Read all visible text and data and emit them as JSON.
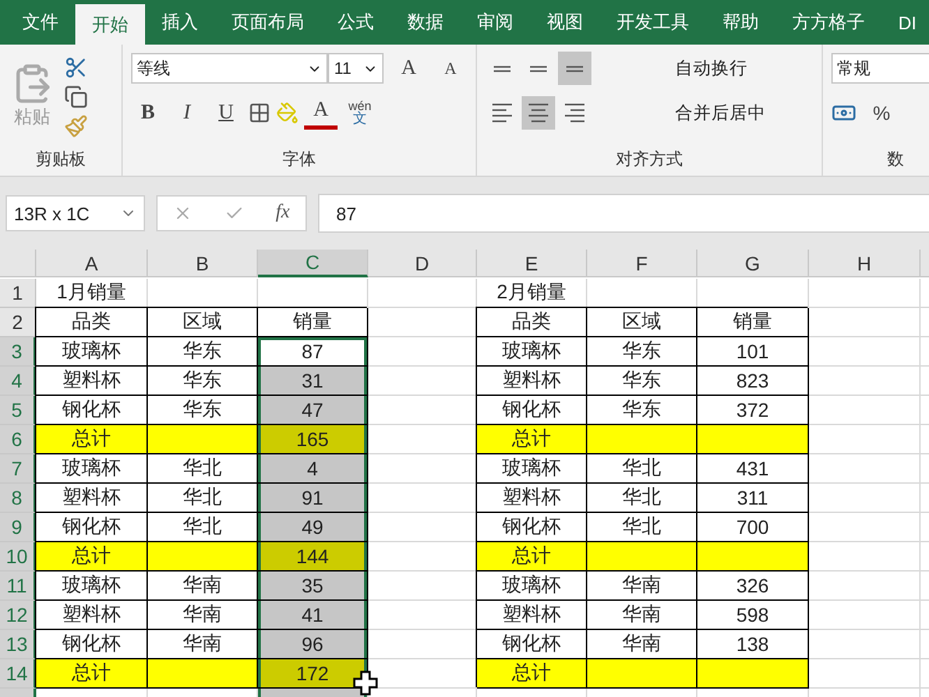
{
  "tabs": [
    {
      "label": "文件",
      "selected": false
    },
    {
      "label": "开始",
      "selected": true
    },
    {
      "label": "插入",
      "selected": false
    },
    {
      "label": "页面布局",
      "selected": false
    },
    {
      "label": "公式",
      "selected": false
    },
    {
      "label": "数据",
      "selected": false
    },
    {
      "label": "审阅",
      "selected": false
    },
    {
      "label": "视图",
      "selected": false
    },
    {
      "label": "开发工具",
      "selected": false
    },
    {
      "label": "帮助",
      "selected": false
    },
    {
      "label": "方方格子",
      "selected": false
    },
    {
      "label": "DI",
      "selected": false
    }
  ],
  "ribbon": {
    "clipboard": {
      "label": "剪贴板",
      "paste": "粘贴"
    },
    "font": {
      "label": "字体",
      "name": "等线",
      "size": "11",
      "grow": "A",
      "shrink": "A",
      "bold": "B",
      "italic": "I",
      "underline": "U",
      "font_color": "A",
      "phonetic": "wén",
      "phonetic_char": "文"
    },
    "alignment": {
      "label": "对齐方式",
      "wrap": "自动换行",
      "merge": "合并后居中",
      "vertical": [
        {
          "selected": false
        },
        {
          "selected": false
        },
        {
          "selected": true
        }
      ],
      "horizontal": [
        {
          "selected": false
        },
        {
          "selected": true
        },
        {
          "selected": false
        }
      ]
    },
    "number": {
      "format": "常规",
      "percent": "%",
      "label": "数"
    }
  },
  "formula_bar": {
    "name_box": "13R x 1C",
    "function_label": "fx",
    "value": "87"
  },
  "sheet": {
    "columns": [
      {
        "label": "A",
        "selected": false
      },
      {
        "label": "B",
        "selected": false
      },
      {
        "label": "C",
        "selected": true
      },
      {
        "label": "D",
        "selected": false
      },
      {
        "label": "E",
        "selected": false
      },
      {
        "label": "F",
        "selected": false
      },
      {
        "label": "G",
        "selected": false
      },
      {
        "label": "H",
        "selected": false
      }
    ],
    "rows": [
      {
        "number": "1",
        "selected": false,
        "cells": [
          {
            "text": "1月销量",
            "highlight": false,
            "border": false,
            "selected": false
          },
          {
            "highlight": false,
            "border": false,
            "selected": false
          },
          {
            "highlight": false,
            "border": false,
            "selected": false
          },
          {
            "highlight": false,
            "border": false,
            "selected": false
          },
          {
            "text": "2月销量",
            "highlight": false,
            "border": false,
            "selected": false
          },
          {
            "highlight": false,
            "border": false,
            "selected": false
          },
          {
            "highlight": false,
            "border": false,
            "selected": false
          },
          {
            "highlight": false,
            "border": false,
            "selected": false
          }
        ]
      },
      {
        "number": "2",
        "selected": false,
        "cells": [
          {
            "text": "品类",
            "highlight": false,
            "border": true,
            "selected": false
          },
          {
            "text": "区域",
            "highlight": false,
            "border": true,
            "selected": false
          },
          {
            "text": "销量",
            "highlight": false,
            "border": true,
            "selected": false
          },
          {
            "highlight": false,
            "border": false,
            "selected": false
          },
          {
            "text": "品类",
            "highlight": false,
            "border": true,
            "selected": false
          },
          {
            "text": "区域",
            "highlight": false,
            "border": true,
            "selected": false
          },
          {
            "text": "销量",
            "highlight": false,
            "border": true,
            "selected": false
          },
          {
            "highlight": false,
            "border": false,
            "selected": false
          }
        ]
      },
      {
        "number": "3",
        "selected": true,
        "cells": [
          {
            "text": "玻璃杯",
            "highlight": false,
            "border": true,
            "selected": false
          },
          {
            "text": "华东",
            "highlight": false,
            "border": true,
            "selected": false
          },
          {
            "text": "87",
            "highlight": false,
            "border": true,
            "selected": true
          },
          {
            "highlight": false,
            "border": false,
            "selected": false
          },
          {
            "text": "玻璃杯",
            "highlight": false,
            "border": true,
            "selected": false
          },
          {
            "text": "华东",
            "highlight": false,
            "border": true,
            "selected": false
          },
          {
            "text": "101",
            "highlight": false,
            "border": true,
            "selected": false
          },
          {
            "highlight": false,
            "border": false,
            "selected": false
          }
        ]
      },
      {
        "number": "4",
        "selected": true,
        "cells": [
          {
            "text": "塑料杯",
            "highlight": false,
            "border": true,
            "selected": false
          },
          {
            "text": "华东",
            "highlight": false,
            "border": true,
            "selected": false
          },
          {
            "text": "31",
            "highlight": false,
            "border": true,
            "selected": true
          },
          {
            "highlight": false,
            "border": false,
            "selected": false
          },
          {
            "text": "塑料杯",
            "highlight": false,
            "border": true,
            "selected": false
          },
          {
            "text": "华东",
            "highlight": false,
            "border": true,
            "selected": false
          },
          {
            "text": "823",
            "highlight": false,
            "border": true,
            "selected": false
          },
          {
            "highlight": false,
            "border": false,
            "selected": false
          }
        ]
      },
      {
        "number": "5",
        "selected": true,
        "cells": [
          {
            "text": "钢化杯",
            "highlight": false,
            "border": true,
            "selected": false
          },
          {
            "text": "华东",
            "highlight": false,
            "border": true,
            "selected": false
          },
          {
            "text": "47",
            "highlight": false,
            "border": true,
            "selected": true
          },
          {
            "highlight": false,
            "border": false,
            "selected": false
          },
          {
            "text": "钢化杯",
            "highlight": false,
            "border": true,
            "selected": false
          },
          {
            "text": "华东",
            "highlight": false,
            "border": true,
            "selected": false
          },
          {
            "text": "372",
            "highlight": false,
            "border": true,
            "selected": false
          },
          {
            "highlight": false,
            "border": false,
            "selected": false
          }
        ]
      },
      {
        "number": "6",
        "selected": true,
        "cells": [
          {
            "text": "总计",
            "highlight": true,
            "border": true,
            "selected": false
          },
          {
            "highlight": true,
            "border": true,
            "selected": false
          },
          {
            "text": "165",
            "highlight": true,
            "border": true,
            "selected": true
          },
          {
            "highlight": false,
            "border": false,
            "selected": false
          },
          {
            "text": "总计",
            "highlight": true,
            "border": true,
            "selected": false
          },
          {
            "highlight": true,
            "border": true,
            "selected": false
          },
          {
            "highlight": true,
            "border": true,
            "selected": false
          },
          {
            "highlight": false,
            "border": false,
            "selected": false
          }
        ]
      },
      {
        "number": "7",
        "selected": true,
        "cells": [
          {
            "text": "玻璃杯",
            "highlight": false,
            "border": true,
            "selected": false
          },
          {
            "text": "华北",
            "highlight": false,
            "border": true,
            "selected": false
          },
          {
            "text": "4",
            "highlight": false,
            "border": true,
            "selected": true
          },
          {
            "highlight": false,
            "border": false,
            "selected": false
          },
          {
            "text": "玻璃杯",
            "highlight": false,
            "border": true,
            "selected": false
          },
          {
            "text": "华北",
            "highlight": false,
            "border": true,
            "selected": false
          },
          {
            "text": "431",
            "highlight": false,
            "border": true,
            "selected": false
          },
          {
            "highlight": false,
            "border": false,
            "selected": false
          }
        ]
      },
      {
        "number": "8",
        "selected": true,
        "cells": [
          {
            "text": "塑料杯",
            "highlight": false,
            "border": true,
            "selected": false
          },
          {
            "text": "华北",
            "highlight": false,
            "border": true,
            "selected": false
          },
          {
            "text": "91",
            "highlight": false,
            "border": true,
            "selected": true
          },
          {
            "highlight": false,
            "border": false,
            "selected": false
          },
          {
            "text": "塑料杯",
            "highlight": false,
            "border": true,
            "selected": false
          },
          {
            "text": "华北",
            "highlight": false,
            "border": true,
            "selected": false
          },
          {
            "text": "311",
            "highlight": false,
            "border": true,
            "selected": false
          },
          {
            "highlight": false,
            "border": false,
            "selected": false
          }
        ]
      },
      {
        "number": "9",
        "selected": true,
        "cells": [
          {
            "text": "钢化杯",
            "highlight": false,
            "border": true,
            "selected": false
          },
          {
            "text": "华北",
            "highlight": false,
            "border": true,
            "selected": false
          },
          {
            "text": "49",
            "highlight": false,
            "border": true,
            "selected": true
          },
          {
            "highlight": false,
            "border": false,
            "selected": false
          },
          {
            "text": "钢化杯",
            "highlight": false,
            "border": true,
            "selected": false
          },
          {
            "text": "华北",
            "highlight": false,
            "border": true,
            "selected": false
          },
          {
            "text": "700",
            "highlight": false,
            "border": true,
            "selected": false
          },
          {
            "highlight": false,
            "border": false,
            "selected": false
          }
        ]
      },
      {
        "number": "10",
        "selected": true,
        "cells": [
          {
            "text": "总计",
            "highlight": true,
            "border": true,
            "selected": false
          },
          {
            "highlight": true,
            "border": true,
            "selected": false
          },
          {
            "text": "144",
            "highlight": true,
            "border": true,
            "selected": true
          },
          {
            "highlight": false,
            "border": false,
            "selected": false
          },
          {
            "text": "总计",
            "highlight": true,
            "border": true,
            "selected": false
          },
          {
            "highlight": true,
            "border": true,
            "selected": false
          },
          {
            "highlight": true,
            "border": true,
            "selected": false
          },
          {
            "highlight": false,
            "border": false,
            "selected": false
          }
        ]
      },
      {
        "number": "11",
        "selected": true,
        "cells": [
          {
            "text": "玻璃杯",
            "highlight": false,
            "border": true,
            "selected": false
          },
          {
            "text": "华南",
            "highlight": false,
            "border": true,
            "selected": false
          },
          {
            "text": "35",
            "highlight": false,
            "border": true,
            "selected": true
          },
          {
            "highlight": false,
            "border": false,
            "selected": false
          },
          {
            "text": "玻璃杯",
            "highlight": false,
            "border": true,
            "selected": false
          },
          {
            "text": "华南",
            "highlight": false,
            "border": true,
            "selected": false
          },
          {
            "text": "326",
            "highlight": false,
            "border": true,
            "selected": false
          },
          {
            "highlight": false,
            "border": false,
            "selected": false
          }
        ]
      },
      {
        "number": "12",
        "selected": true,
        "cells": [
          {
            "text": "塑料杯",
            "highlight": false,
            "border": true,
            "selected": false
          },
          {
            "text": "华南",
            "highlight": false,
            "border": true,
            "selected": false
          },
          {
            "text": "41",
            "highlight": false,
            "border": true,
            "selected": true
          },
          {
            "highlight": false,
            "border": false,
            "selected": false
          },
          {
            "text": "塑料杯",
            "highlight": false,
            "border": true,
            "selected": false
          },
          {
            "text": "华南",
            "highlight": false,
            "border": true,
            "selected": false
          },
          {
            "text": "598",
            "highlight": false,
            "border": true,
            "selected": false
          },
          {
            "highlight": false,
            "border": false,
            "selected": false
          }
        ]
      },
      {
        "number": "13",
        "selected": true,
        "cells": [
          {
            "text": "钢化杯",
            "highlight": false,
            "border": true,
            "selected": false
          },
          {
            "text": "华南",
            "highlight": false,
            "border": true,
            "selected": false
          },
          {
            "text": "96",
            "highlight": false,
            "border": true,
            "selected": true
          },
          {
            "highlight": false,
            "border": false,
            "selected": false
          },
          {
            "text": "钢化杯",
            "highlight": false,
            "border": true,
            "selected": false
          },
          {
            "text": "华南",
            "highlight": false,
            "border": true,
            "selected": false
          },
          {
            "text": "138",
            "highlight": false,
            "border": true,
            "selected": false
          },
          {
            "highlight": false,
            "border": false,
            "selected": false
          }
        ]
      },
      {
        "number": "14",
        "selected": true,
        "cells": [
          {
            "text": "总计",
            "highlight": true,
            "border": true,
            "selected": false
          },
          {
            "highlight": true,
            "border": true,
            "selected": false
          },
          {
            "text": "172",
            "highlight": true,
            "border": true,
            "selected": true
          },
          {
            "highlight": false,
            "border": false,
            "selected": false
          },
          {
            "text": "总计",
            "highlight": true,
            "border": true,
            "selected": false
          },
          {
            "highlight": true,
            "border": true,
            "selected": false
          },
          {
            "highlight": true,
            "border": true,
            "selected": false
          },
          {
            "highlight": false,
            "border": false,
            "selected": false
          }
        ]
      },
      {
        "selected": true,
        "cells": [
          {
            "highlight": false,
            "border": false,
            "selected": false
          },
          {
            "highlight": false,
            "border": false,
            "selected": false
          },
          {
            "highlight": false,
            "border": false,
            "selected": true
          },
          {
            "highlight": false,
            "border": false,
            "selected": false
          },
          {
            "highlight": false,
            "border": false,
            "selected": false
          },
          {
            "highlight": false,
            "border": false,
            "selected": false
          },
          {
            "highlight": false,
            "border": false,
            "selected": false
          },
          {
            "highlight": false,
            "border": false,
            "selected": false
          }
        ]
      }
    ]
  }
}
